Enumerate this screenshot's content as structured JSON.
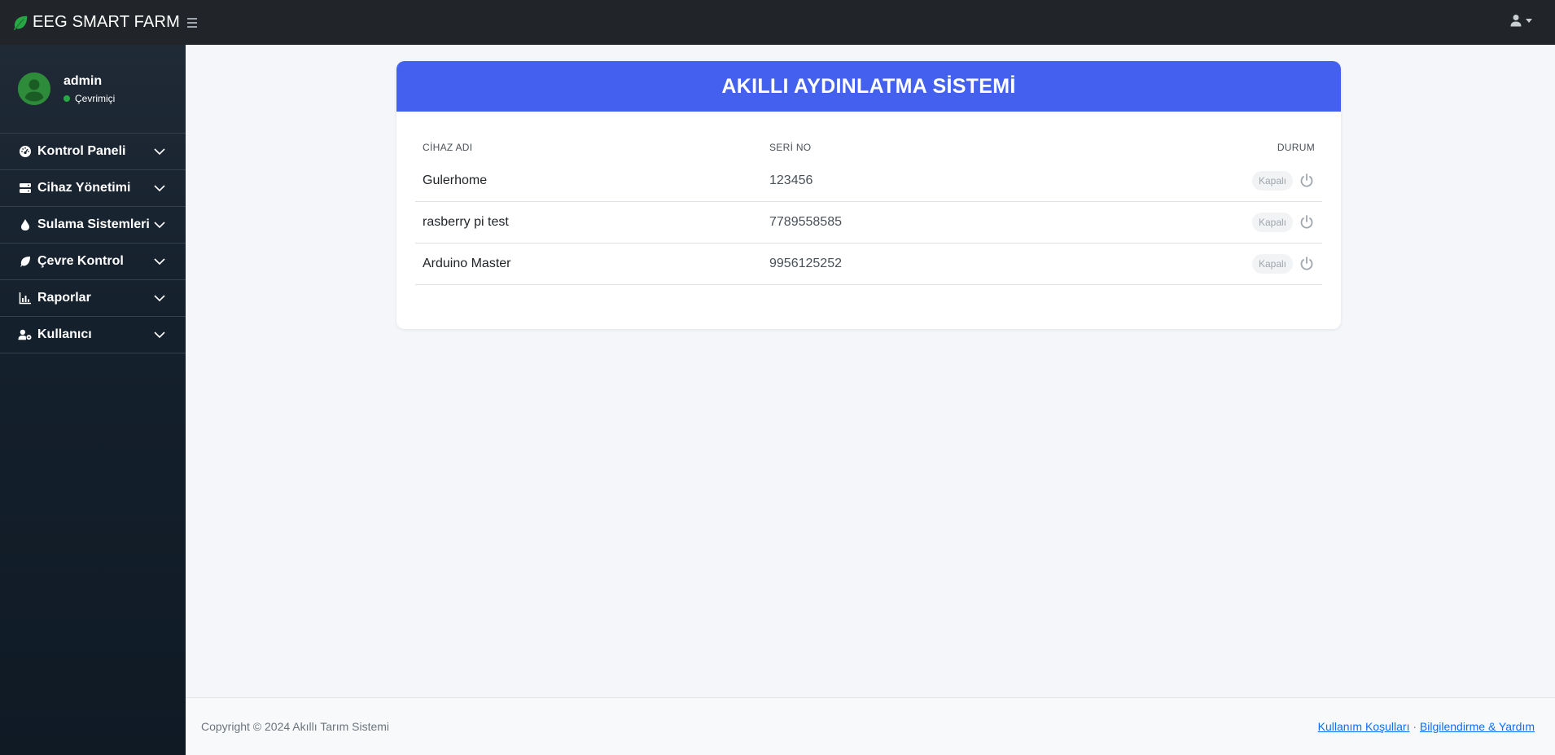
{
  "brand": {
    "name": "EEG SMART FARM",
    "icon": "leaf-icon",
    "icon_color": "#28a745"
  },
  "header": {
    "menu_icon": "hamburger-icon",
    "user_icon": "user-icon"
  },
  "user_panel": {
    "name": "admin",
    "status": "Çevrimiçi",
    "status_color": "#28a745",
    "avatar_color": "#2e8b3a"
  },
  "sidebar": {
    "items": [
      {
        "label": "Kontrol Paneli",
        "icon": "gauge-icon"
      },
      {
        "label": "Cihaz Yönetimi",
        "icon": "server-icon"
      },
      {
        "label": "Sulama Sistemleri",
        "icon": "droplet-icon"
      },
      {
        "label": "Çevre Kontrol",
        "icon": "leaf-icon"
      },
      {
        "label": "Raporlar",
        "icon": "chart-icon"
      },
      {
        "label": "Kullanıcı",
        "icon": "user-gear-icon"
      }
    ]
  },
  "main": {
    "title": "AKILLI AYDINLATMA SİSTEMİ",
    "header_color": "#4361ee",
    "table": {
      "headers": {
        "name": "CİHAZ ADI",
        "serial": "SERİ NO",
        "status": "DURUM"
      },
      "rows": [
        {
          "name": "Gulerhome",
          "serial": "123456",
          "status": "Kapalı"
        },
        {
          "name": "rasberry pi test",
          "serial": "7789558585",
          "status": "Kapalı"
        },
        {
          "name": "Arduino Master",
          "serial": "9956125252",
          "status": "Kapalı"
        }
      ]
    }
  },
  "footer": {
    "copyright": "Copyright © 2024 Akıllı Tarım Sistemi",
    "link1": "Kullanım Koşulları",
    "separator": "·",
    "link2": "Bilgilendirme & Yardım"
  }
}
